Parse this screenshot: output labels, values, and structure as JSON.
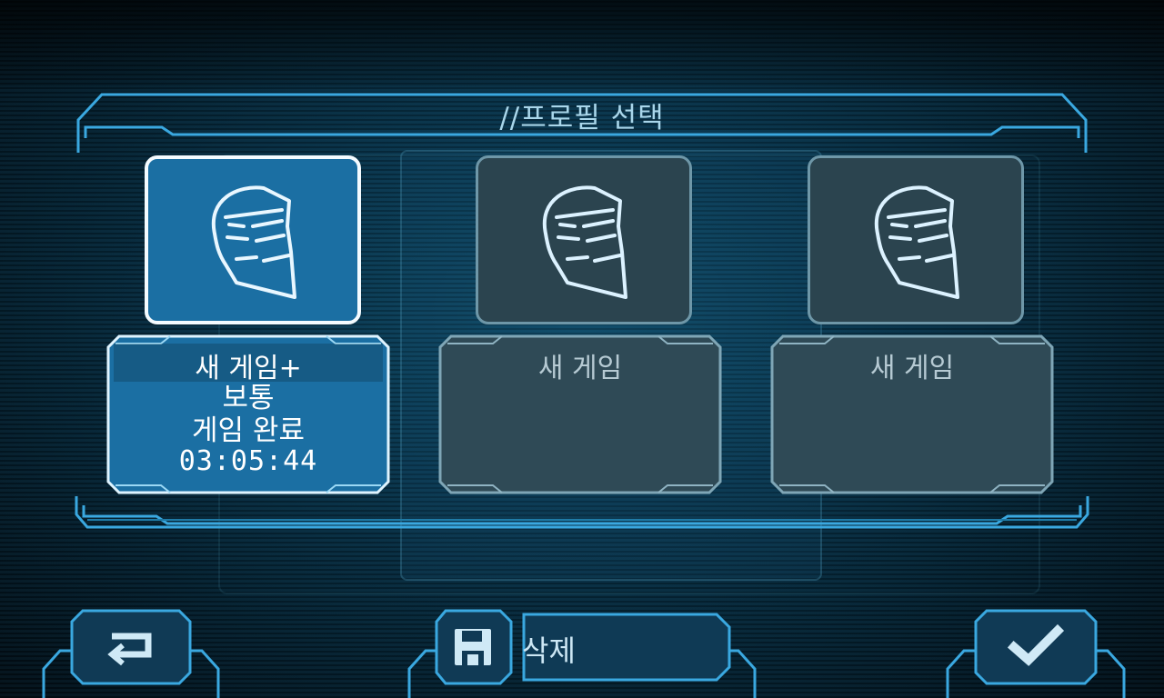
{
  "header": {
    "title": "//프로필 선택"
  },
  "profiles": [
    {
      "name": "새 게임+",
      "difficulty": "보통",
      "status": "게임 완료",
      "playtime": "03:05:44",
      "selected": true
    },
    {
      "name": "새 게임",
      "selected": false
    },
    {
      "name": "새 게임",
      "selected": false
    }
  ],
  "footer": {
    "delete_label": "삭제"
  },
  "icons": {
    "profile": "helmet-icon",
    "back": "back-arrow-icon",
    "save": "floppy-disk-icon",
    "confirm": "checkmark-icon"
  },
  "colors": {
    "accent": "#1b6fa3",
    "frame": "#3aa8e0",
    "empty_card": "#2b444f",
    "selected_border": "#f4fbff"
  }
}
